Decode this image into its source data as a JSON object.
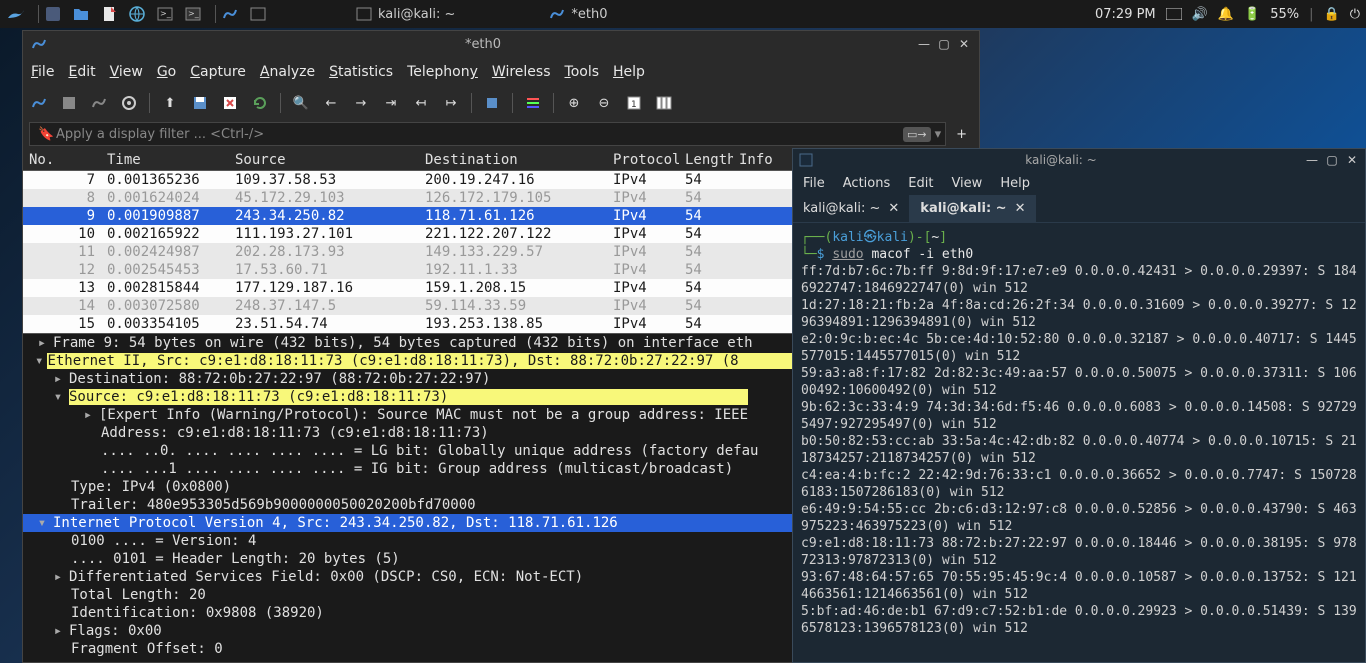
{
  "panel": {
    "tasks": [
      {
        "icon": "terminal-small",
        "label": "kali@kali: ~"
      },
      {
        "icon": "wireshark-small",
        "label": "*eth0"
      }
    ],
    "time": "07:29 PM",
    "battery": "55%"
  },
  "wireshark": {
    "title": "*eth0",
    "menu": [
      "File",
      "Edit",
      "View",
      "Go",
      "Capture",
      "Analyze",
      "Statistics",
      "Telephony",
      "Wireless",
      "Tools",
      "Help"
    ],
    "filter_placeholder": "Apply a display filter ... <Ctrl-/>",
    "plus": "+",
    "columns": [
      "No.",
      "Time",
      "Source",
      "Destination",
      "Protocol",
      "Length",
      "Info"
    ],
    "packets": [
      {
        "no": "7",
        "time": "0.001365236",
        "src": "109.37.58.53",
        "dst": "200.19.247.16",
        "proto": "IPv4",
        "len": "54",
        "style": "white"
      },
      {
        "no": "8",
        "time": "0.001624024",
        "src": "45.172.29.103",
        "dst": "126.172.179.105",
        "proto": "IPv4",
        "len": "54",
        "style": "gray"
      },
      {
        "no": "9",
        "time": "0.001909887",
        "src": "243.34.250.82",
        "dst": "118.71.61.126",
        "proto": "IPv4",
        "len": "54",
        "style": "sel"
      },
      {
        "no": "10",
        "time": "0.002165922",
        "src": "111.193.27.101",
        "dst": "221.122.207.122",
        "proto": "IPv4",
        "len": "54",
        "style": "white"
      },
      {
        "no": "11",
        "time": "0.002424987",
        "src": "202.28.173.93",
        "dst": "149.133.229.57",
        "proto": "IPv4",
        "len": "54",
        "style": "gray"
      },
      {
        "no": "12",
        "time": "0.002545453",
        "src": "17.53.60.71",
        "dst": "192.11.1.33",
        "proto": "IPv4",
        "len": "54",
        "style": "gray"
      },
      {
        "no": "13",
        "time": "0.002815844",
        "src": "177.129.187.16",
        "dst": "159.1.208.15",
        "proto": "IPv4",
        "len": "54",
        "style": "white"
      },
      {
        "no": "14",
        "time": "0.003072580",
        "src": "248.37.147.5",
        "dst": "59.114.33.59",
        "proto": "IPv4",
        "len": "54",
        "style": "gray"
      },
      {
        "no": "15",
        "time": "0.003354105",
        "src": "23.51.54.74",
        "dst": "193.253.138.85",
        "proto": "IPv4",
        "len": "54",
        "style": "white"
      }
    ],
    "details": {
      "frame": "Frame 9: 54 bytes on wire (432 bits), 54 bytes captured (432 bits) on interface eth",
      "eth": "Ethernet II, Src: c9:e1:d8:18:11:73 (c9:e1:d8:18:11:73), Dst: 88:72:0b:27:22:97 (8",
      "dest": "Destination: 88:72:0b:27:22:97 (88:72:0b:27:22:97)",
      "src": "Source: c9:e1:d8:18:11:73 (c9:e1:d8:18:11:73)",
      "expert": "[Expert Info (Warning/Protocol): Source MAC must not be a group address: IEEE",
      "addr": "Address: c9:e1:d8:18:11:73 (c9:e1:d8:18:11:73)",
      "lg": ".... ..0. .... .... .... .... = LG bit: Globally unique address (factory defau",
      "ig": ".... ...1 .... .... .... .... = IG bit: Group address (multicast/broadcast)",
      "type": "Type: IPv4 (0x0800)",
      "trailer": "Trailer: 480e953305d569b9000000050020200bfd70000",
      "ipv4": "Internet Protocol Version 4, Src: 243.34.250.82, Dst: 118.71.61.126",
      "ver": "0100 .... = Version: 4",
      "hlen": ".... 0101 = Header Length: 20 bytes (5)",
      "dsf": "Differentiated Services Field: 0x00 (DSCP: CS0, ECN: Not-ECT)",
      "tlen": "Total Length: 20",
      "ident": "Identification: 0x9808 (38920)",
      "flags": "Flags: 0x00",
      "frag": "Fragment Offset: 0"
    }
  },
  "terminal": {
    "title": "kali@kali: ~",
    "menu": [
      "File",
      "Actions",
      "Edit",
      "View",
      "Help"
    ],
    "tabs": [
      "kali@kali: ~",
      "kali@kali: ~"
    ],
    "prompt_user": "kali㉿kali",
    "prompt_path": "~",
    "cmd_sudo": "sudo",
    "cmd_rest": " macof -i eth0",
    "lines": [
      "ff:7d:b7:6c:7b:ff 9:8d:9f:17:e7:e9 0.0.0.0.42431 > 0.0.0.0.29397: S 184",
      "6922747:1846922747(0) win 512",
      "1d:27:18:21:fb:2a 4f:8a:cd:26:2f:34 0.0.0.0.31609 > 0.0.0.0.39277: S 12",
      "96394891:1296394891(0) win 512",
      "e2:0:9c:b:ec:4c 5b:ce:4d:10:52:80 0.0.0.0.32187 > 0.0.0.0.40717: S 1445",
      "577015:1445577015(0) win 512",
      "59:a3:a8:f:17:82 2d:82:3c:49:aa:57 0.0.0.0.50075 > 0.0.0.0.37311: S 106",
      "00492:10600492(0) win 512",
      "9b:62:3c:33:4:9 74:3d:34:6d:f5:46 0.0.0.0.6083 > 0.0.0.0.14508: S 92729",
      "5497:927295497(0) win 512",
      "b0:50:82:53:cc:ab 33:5a:4c:42:db:82 0.0.0.0.40774 > 0.0.0.0.10715: S 21",
      "18734257:2118734257(0) win 512",
      "c4:ea:4:b:fc:2 22:42:9d:76:33:c1 0.0.0.0.36652 > 0.0.0.0.7747: S 150728",
      "6183:1507286183(0) win 512",
      "e6:49:9:54:55:cc 2b:c6:d3:12:97:c8 0.0.0.0.52856 > 0.0.0.0.43790: S 463",
      "975223:463975223(0) win 512",
      "c9:e1:d8:18:11:73 88:72:b:27:22:97 0.0.0.0.18446 > 0.0.0.0.38195: S 978",
      "72313:97872313(0) win 512",
      "93:67:48:64:57:65 70:55:95:45:9c:4 0.0.0.0.10587 > 0.0.0.0.13752: S 121",
      "4663561:1214663561(0) win 512",
      "5:bf:ad:46:de:b1 67:d9:c7:52:b1:de 0.0.0.0.29923 > 0.0.0.0.51439: S 139",
      "6578123:1396578123(0) win 512"
    ]
  }
}
